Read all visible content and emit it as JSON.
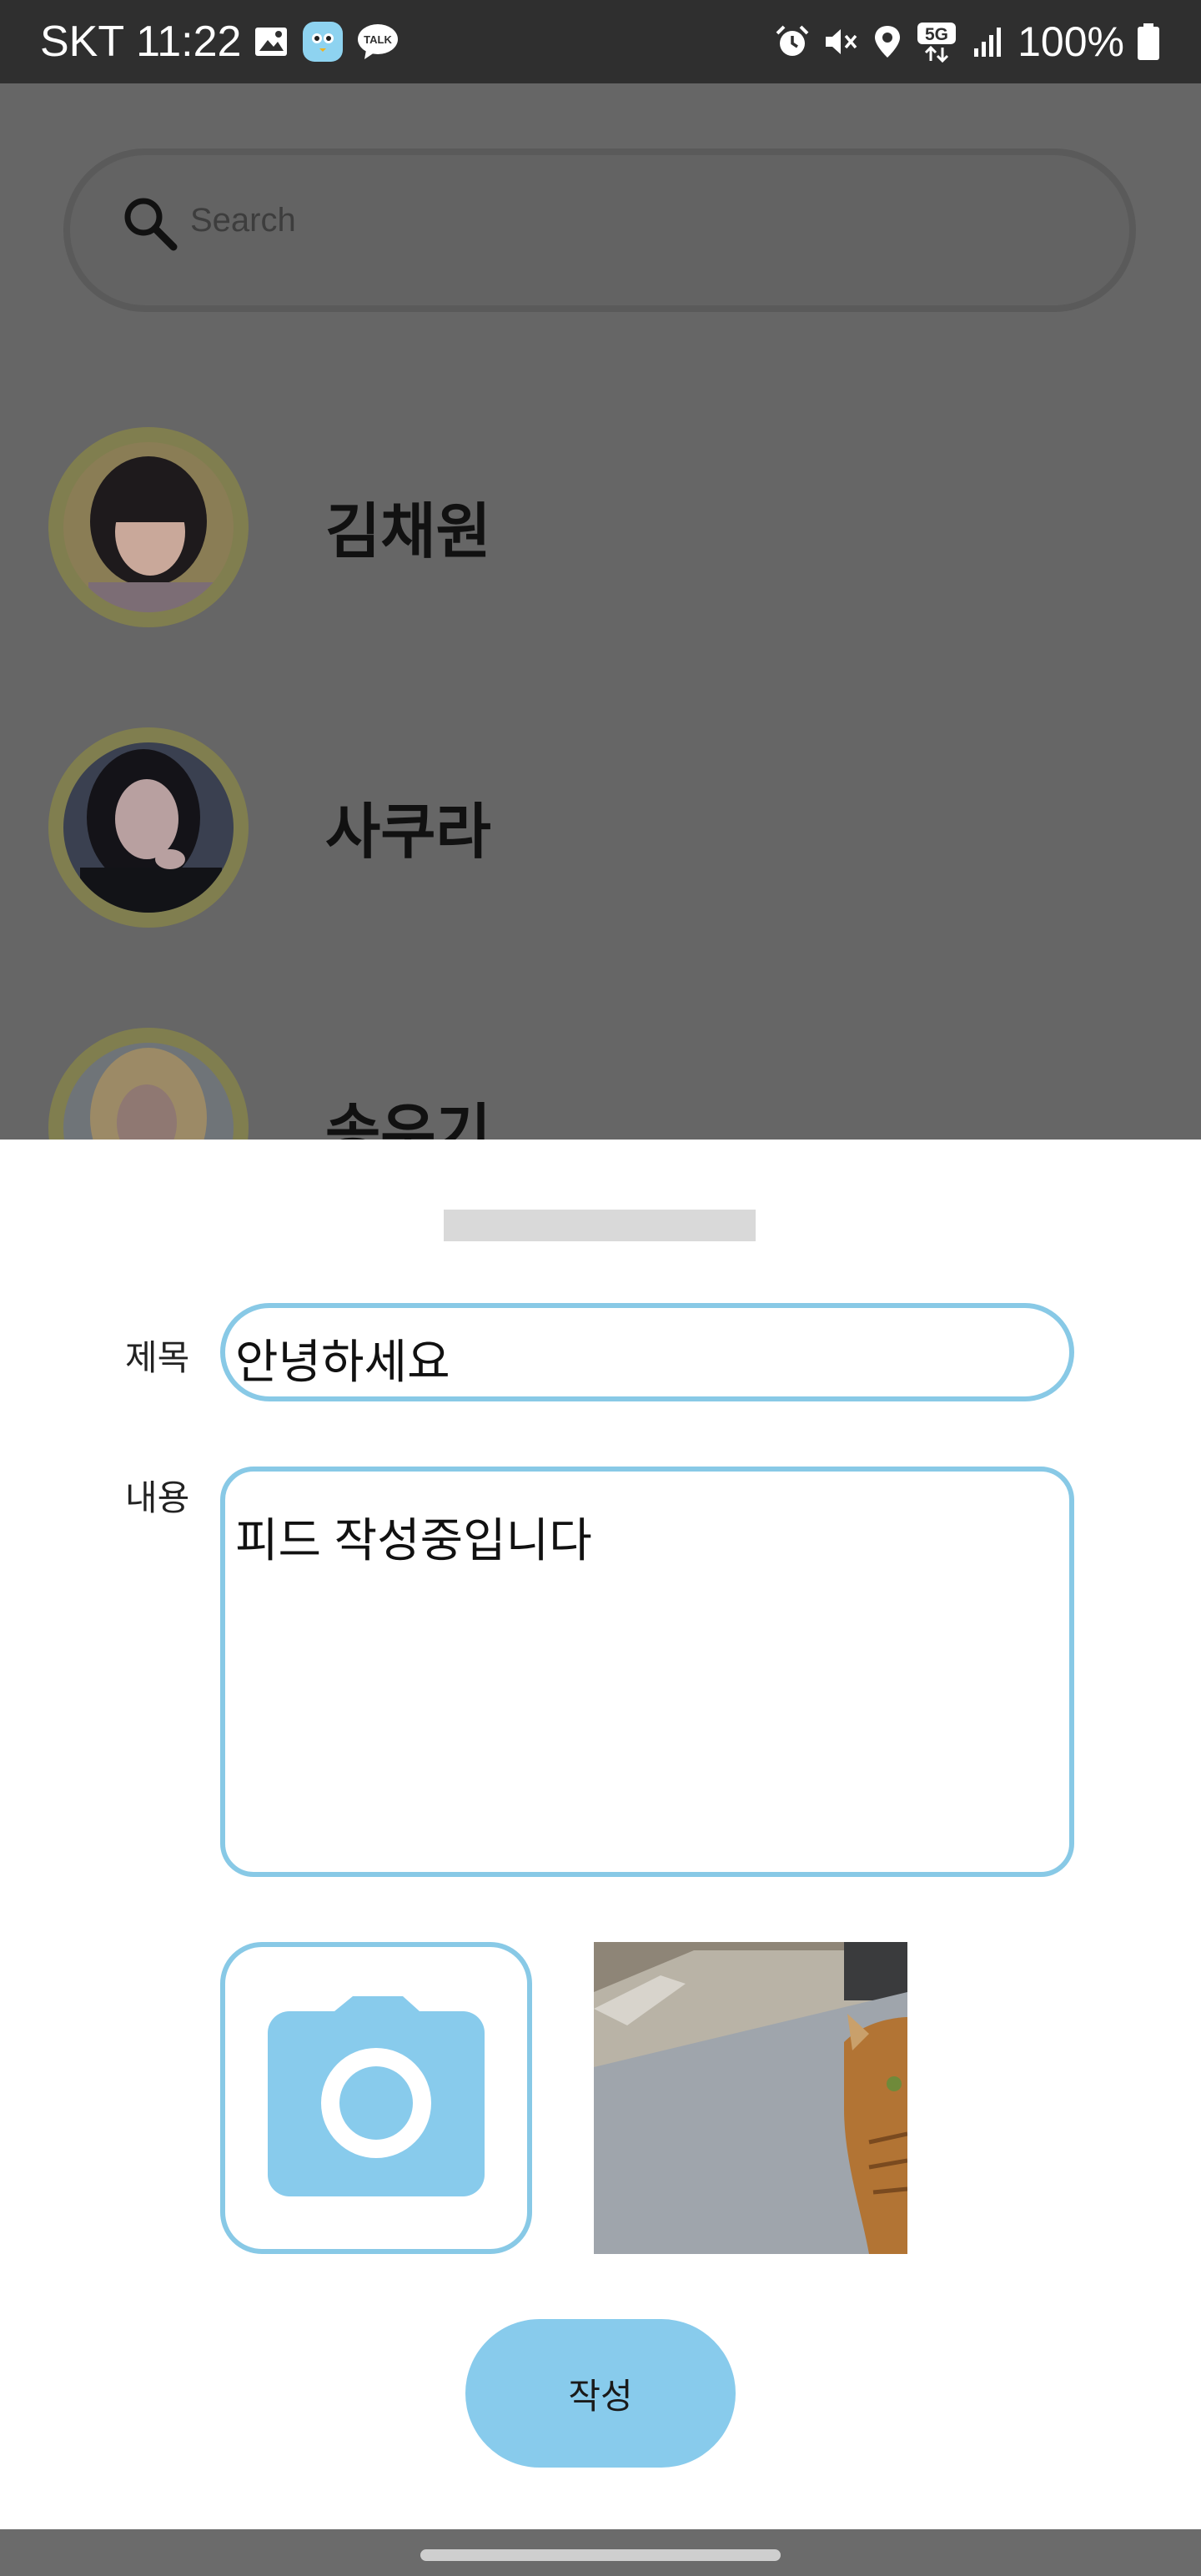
{
  "status_bar": {
    "carrier": "SKT",
    "time": "11:22",
    "kakao_badge": "TALK",
    "network": "5G",
    "battery": "100%",
    "icons": [
      "image-icon",
      "kakao-app-icon",
      "kakaotalk-icon",
      "alarm-icon",
      "mute-icon",
      "location-icon",
      "network-5g-icon",
      "signal-icon",
      "battery-icon"
    ]
  },
  "search": {
    "placeholder": "Search",
    "icon": "search-icon"
  },
  "friends": [
    {
      "name": "김채원"
    },
    {
      "name": "사쿠라"
    },
    {
      "name": "송우기"
    }
  ],
  "sheet": {
    "title_label": "제목",
    "title_value": "안녕하세요",
    "content_label": "내용",
    "content_value": "피드 작성중입니다",
    "camera_icon": "camera-icon",
    "submit_label": "작성"
  },
  "colors": {
    "accent": "#88c9e6",
    "ring": "#807e4f",
    "overlay": "#666666"
  }
}
